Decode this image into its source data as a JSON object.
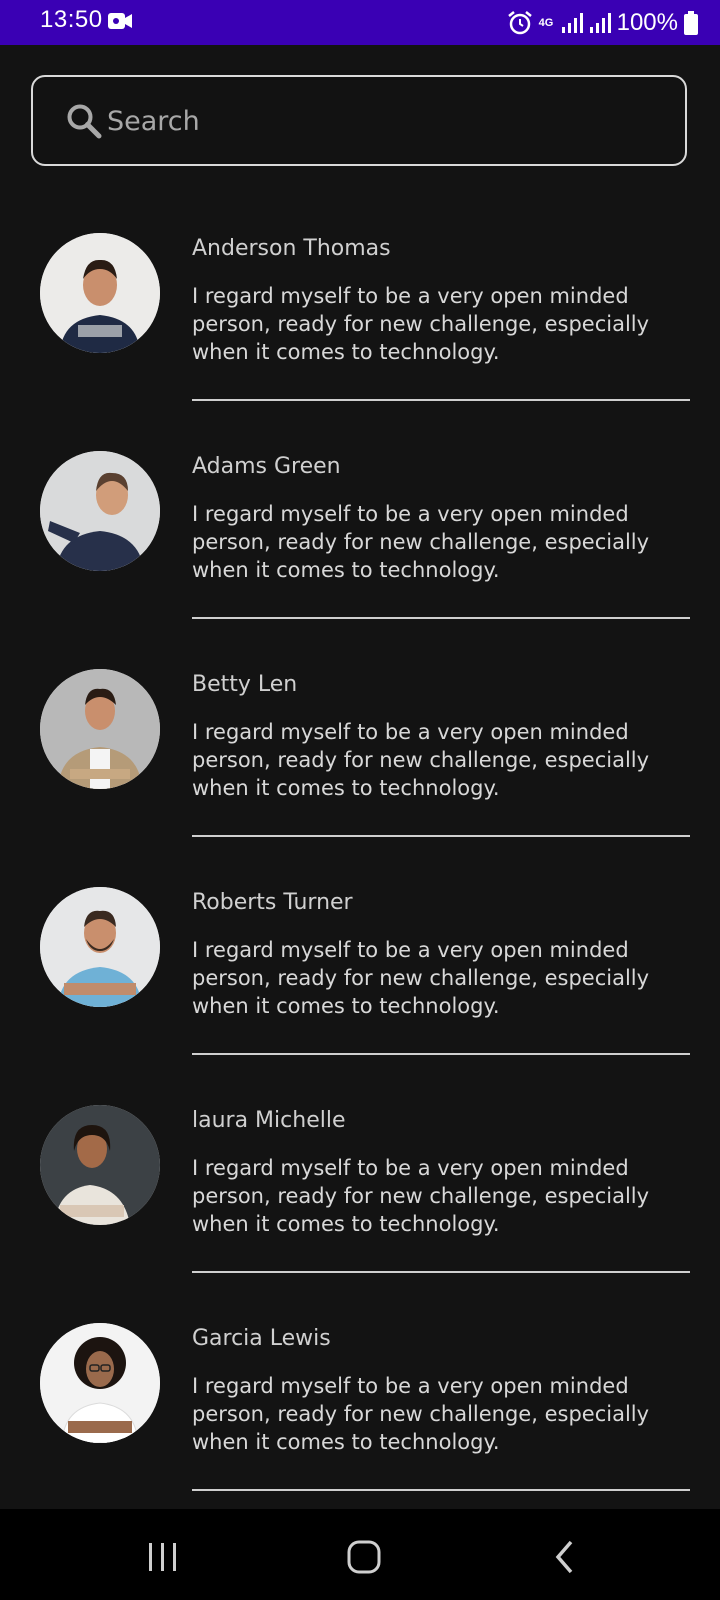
{
  "status": {
    "time": "13:50",
    "network": "4G",
    "battery": "100%"
  },
  "search": {
    "placeholder": "Search",
    "value": ""
  },
  "contacts": [
    {
      "name": "Anderson Thomas",
      "bio": "I regard myself to be a very open minded person, ready for new challenge, especially when it comes to technology."
    },
    {
      "name": "Adams Green",
      "bio": "I regard myself to be a very open minded person, ready for new challenge, especially when it comes to technology."
    },
    {
      "name": "Betty Len",
      "bio": "I regard myself to be a very open minded person, ready for new challenge, especially when it comes to technology."
    },
    {
      "name": "Roberts Turner",
      "bio": "I regard myself to be a very open minded person, ready for new challenge, especially when it comes to technology."
    },
    {
      "name": "laura Michelle",
      "bio": "I regard myself to be a very open minded person, ready for new challenge, especially when it comes to technology."
    },
    {
      "name": "Garcia Lewis",
      "bio": "I regard myself to be a very open minded person, ready for new challenge, especially when it comes to technology."
    }
  ],
  "colors": {
    "status_bar": "#3a00b4",
    "background": "#131313",
    "text": "#d0d0d0"
  },
  "icons": {
    "search": "search-icon",
    "video": "video-icon",
    "alarm": "alarm-icon",
    "signal": "signal-icon",
    "battery": "battery-icon",
    "recents": "recents-icon",
    "home": "home-icon",
    "back": "back-icon"
  }
}
